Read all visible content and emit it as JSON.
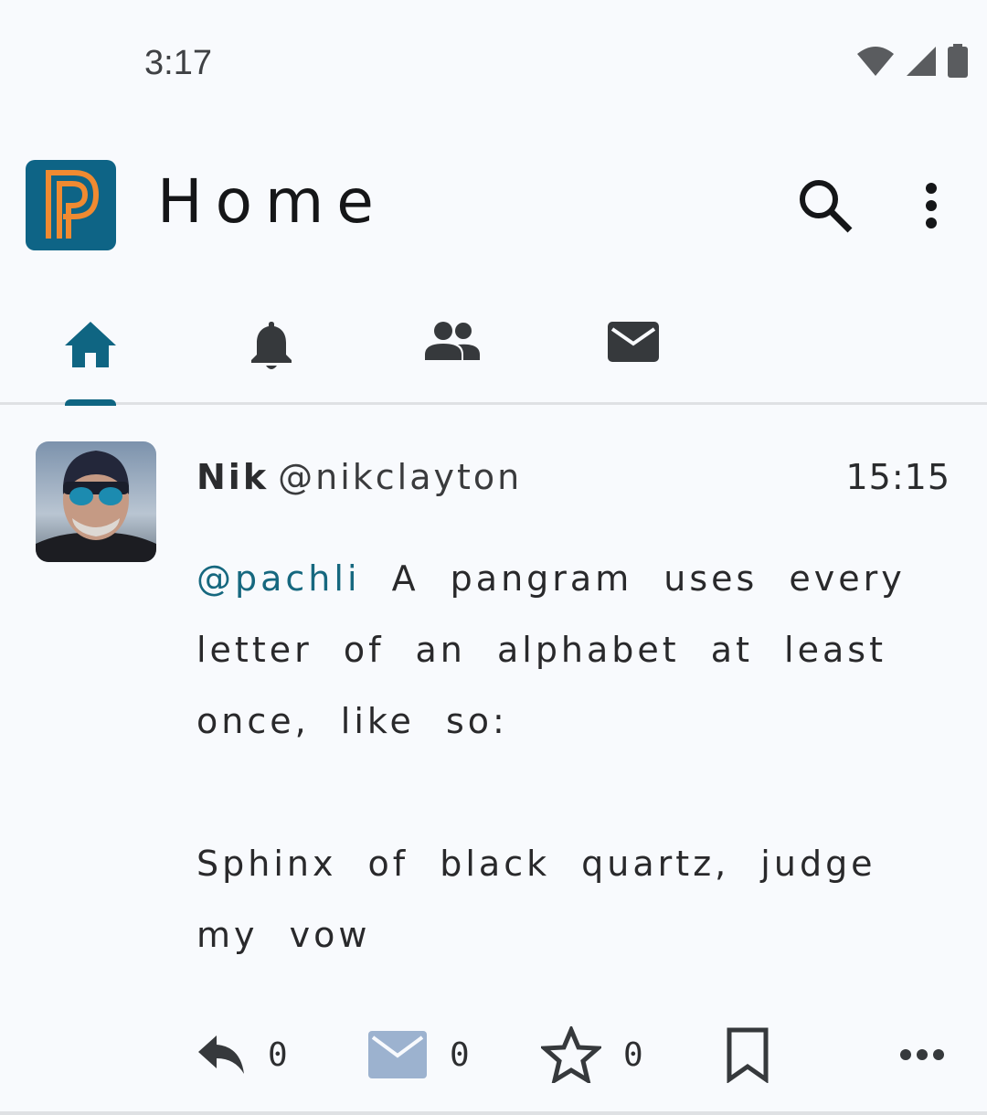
{
  "status_bar": {
    "time": "3:17",
    "icons": [
      "wifi-icon",
      "signal-icon",
      "battery-icon"
    ]
  },
  "app_bar": {
    "title": "Home",
    "logo": "pachli-logo",
    "actions": [
      "search-icon",
      "more-vert-icon"
    ]
  },
  "tabs": [
    {
      "name": "home",
      "icon": "home-icon",
      "selected": true
    },
    {
      "name": "notifications",
      "icon": "bell-icon",
      "selected": false
    },
    {
      "name": "local",
      "icon": "people-icon",
      "selected": false
    },
    {
      "name": "direct-messages",
      "icon": "mail-icon",
      "selected": false
    }
  ],
  "post": {
    "display_name": "Nik",
    "handle": "@nikclayton",
    "time": "15:15",
    "mention": "@pachli",
    "body_first": "A pangram uses every letter of an alphabet at least once, like so:",
    "body_second": "Sphinx of black quartz, judge my vow",
    "actions": {
      "reply_count": "0",
      "reblog_count": "0",
      "favourite_count": "0"
    }
  },
  "colors": {
    "background": "#f8fafd",
    "accent": "#0f6582",
    "logo_background": "#0e6486",
    "logo_stroke": "#f08a31",
    "direct_message_icon": "#9cb2cf"
  }
}
